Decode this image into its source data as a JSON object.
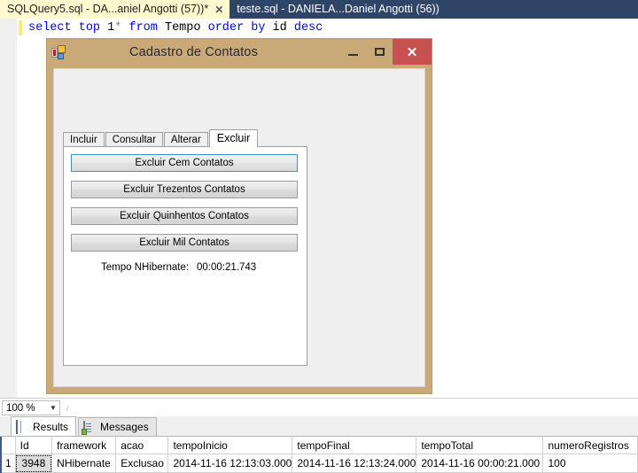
{
  "ide": {
    "doc_tabs": [
      {
        "label": "SQLQuery5.sql - DA...aniel Angotti (57))*",
        "active": true,
        "close": "✕"
      },
      {
        "label": "teste.sql - DANIELA...Daniel Angotti (56))",
        "active": false
      }
    ],
    "sql": {
      "kw_select": "select",
      "kw_top": "top",
      "one": "1",
      "star": "*",
      "kw_from": "from",
      "table": "Tempo",
      "kw_order": "order",
      "kw_by": "by",
      "col": "id",
      "kw_desc": "desc"
    }
  },
  "dialog": {
    "title": "Cadastro de Contatos",
    "icon": "winforms-app-icon",
    "minimize": "–",
    "maximize": "□",
    "close": "✕",
    "tabs": [
      {
        "label": "Incluir",
        "selected": false
      },
      {
        "label": "Consultar",
        "selected": false
      },
      {
        "label": "Alterar",
        "selected": false
      },
      {
        "label": "Excluir",
        "selected": true
      }
    ],
    "buttons": [
      {
        "label": "Excluir Cem Contatos",
        "focused": true
      },
      {
        "label": "Excluir Trezentos Contatos",
        "focused": false
      },
      {
        "label": "Excluir Quinhentos Contatos",
        "focused": false
      },
      {
        "label": "Excluir Mil Contatos",
        "focused": false
      }
    ],
    "time_label": "Tempo NHibernate:",
    "time_value": "00:00:21.743"
  },
  "results": {
    "zoom": {
      "value": "100 %",
      "arrow": "▼",
      "nav_icon": "‹"
    },
    "tabs": [
      {
        "label": "Results",
        "icon": "grid-icon",
        "selected": true
      },
      {
        "label": "Messages",
        "icon": "message-icon",
        "selected": false
      }
    ],
    "grid": {
      "row_header": "",
      "columns": [
        "Id",
        "framework",
        "acao",
        "tempoInicio",
        "tempoFinal",
        "tempoTotal",
        "numeroRegistros"
      ],
      "rows": [
        {
          "num": "1",
          "cells": [
            "3948",
            "NHibernate",
            "Exclusao",
            "2014-11-16 12:13:03.000",
            "2014-11-16 12:13:24.000",
            "2014-11-16 00:00:21.000",
            "100"
          ]
        }
      ]
    }
  },
  "colors": {
    "ide_tabstrip": "#2f4568",
    "active_tab": "#fff9cf",
    "dialog_frame": "#c9a977",
    "close_button": "#c75050",
    "focus_border": "#3c8fd4",
    "change_bar": "#ffec6e"
  }
}
